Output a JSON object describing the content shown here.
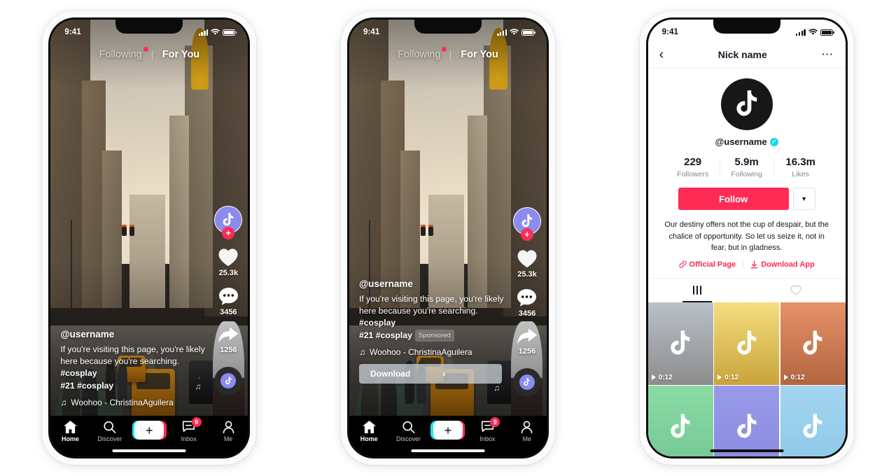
{
  "colors": {
    "brand_red": "#fe2c55",
    "brand_cyan": "#22e4ec",
    "verified_blue": "#20d5ec",
    "avatar_purple": "#8b8bee",
    "profile_avatar_bg": "#17171a",
    "text_dark": "#161823",
    "text_muted": "#86878b"
  },
  "phone1": {
    "name": "tiktok-feed-organic",
    "status_bar": {
      "time": "9:41",
      "signal_icon": "cellular-bars-icon",
      "wifi_icon": "wifi-icon",
      "battery_icon": "battery-icon"
    },
    "feed_tabs": {
      "following": "Following",
      "for_you": "For You",
      "active": "For You",
      "notification_dot": "red-dot-indicator"
    },
    "rail": {
      "avatar_icon": "tiktok-note-avatar-icon",
      "follow_plus": "+",
      "like_icon": "heart-icon",
      "like_count": "25.3k",
      "comment_icon": "comment-bubble-icon",
      "comment_count": "3456",
      "share_icon": "share-arrow-icon",
      "share_count": "1256",
      "music_disc_icon": "music-disc-icon"
    },
    "caption": {
      "username": "@username",
      "line1": "If you're visiting this page, you're likely",
      "line2_plain": "here because you're searching. ",
      "line2_tag": "#cosplay",
      "line3": "#21 #cosplay",
      "music_icon": "music-note-icon",
      "music": "Woohoo - ChristinaAguilera"
    },
    "tabbar": [
      {
        "label": "Home",
        "icon": "home-icon",
        "active": true
      },
      {
        "label": "Discover",
        "icon": "search-icon",
        "active": false
      },
      {
        "label": "",
        "icon": "create-plus-icon",
        "active": false
      },
      {
        "label": "Inbox",
        "icon": "inbox-message-icon",
        "active": false,
        "badge": "9"
      },
      {
        "label": "Me",
        "icon": "person-icon",
        "active": false
      }
    ]
  },
  "phone2": {
    "name": "tiktok-feed-sponsored-ad",
    "status_bar": {
      "time": "9:41",
      "signal_icon": "cellular-bars-icon",
      "wifi_icon": "wifi-icon",
      "battery_icon": "battery-icon"
    },
    "feed_tabs": {
      "following": "Following",
      "for_you": "For You",
      "active": "For You",
      "notification_dot": "red-dot-indicator"
    },
    "rail": {
      "avatar_icon": "tiktok-note-avatar-icon",
      "follow_plus": "+",
      "like_icon": "heart-icon",
      "like_count": "25.3k",
      "comment_icon": "comment-bubble-icon",
      "comment_count": "3456",
      "share_icon": "share-arrow-icon",
      "share_count": "1256",
      "music_disc_icon": "music-disc-icon"
    },
    "caption": {
      "username": "@username",
      "line1": "If you're visiting this page, you're likely",
      "line2_plain": "here because you're searching. ",
      "line2_tag": "#cosplay",
      "line3": "#21 #cosplay",
      "sponsored_badge": "Sponsored",
      "music_icon": "music-note-icon",
      "music": "Woohoo - ChristinaAguilera"
    },
    "cta": {
      "label": "Download",
      "chevron": "›"
    },
    "tabbar": [
      {
        "label": "Home",
        "icon": "home-icon",
        "active": true
      },
      {
        "label": "Discover",
        "icon": "search-icon",
        "active": false
      },
      {
        "label": "",
        "icon": "create-plus-icon",
        "active": false
      },
      {
        "label": "Inbox",
        "icon": "inbox-message-icon",
        "active": false,
        "badge": "9"
      },
      {
        "label": "Me",
        "icon": "person-icon",
        "active": false
      }
    ]
  },
  "phone3": {
    "name": "tiktok-profile",
    "status_bar": {
      "time": "9:41",
      "signal_icon": "cellular-bars-icon",
      "wifi_icon": "wifi-icon",
      "battery_icon": "battery-icon"
    },
    "nav": {
      "back_icon": "chevron-left-icon",
      "title": "Nick name",
      "more_icon": "more-dots-icon"
    },
    "avatar_icon": "tiktok-note-icon",
    "username": "@username",
    "verified_icon": "verified-check-icon",
    "stats": [
      {
        "value": "229",
        "label": "Followers"
      },
      {
        "value": "5.9m",
        "label": "Following"
      },
      {
        "value": "16.3m",
        "label": "Likes"
      }
    ],
    "follow_button": "Follow",
    "dropdown_icon": "chevron-down-icon",
    "bio": "Our destiny offers not the cup of despair, but the chalice of opportunity. So let us seize it, not in fear, but in gladness.",
    "links": [
      {
        "label": "Official Page",
        "icon": "link-chain-icon"
      },
      {
        "label": "Download App",
        "icon": "download-icon"
      }
    ],
    "tabs": [
      {
        "icon": "grid-icon",
        "active": true
      },
      {
        "icon": "heart-outline-icon",
        "active": false
      }
    ],
    "videos": [
      {
        "duration": "0:12",
        "color_top": "#b9c0c8",
        "color_bottom": "#8d8d8d",
        "icon": "tiktok-note-icon",
        "show_duration": true
      },
      {
        "duration": "0:12",
        "color_top": "#f5dd7e",
        "color_bottom": "#c9a43c",
        "icon": "tiktok-note-icon",
        "show_duration": true
      },
      {
        "duration": "0:12",
        "color_top": "#e79169",
        "color_bottom": "#b2663f",
        "icon": "tiktok-note-icon",
        "show_duration": true
      },
      {
        "duration": "",
        "color_top": "#8adba4",
        "color_bottom": "#74c693",
        "icon": "tiktok-note-icon",
        "show_duration": false
      },
      {
        "duration": "",
        "color_top": "#9a9aea",
        "color_bottom": "#8a8ae0",
        "icon": "tiktok-note-icon",
        "show_duration": false
      },
      {
        "duration": "",
        "color_top": "#a3d5ef",
        "color_bottom": "#8cc8e8",
        "icon": "tiktok-note-icon",
        "show_duration": false
      }
    ]
  }
}
